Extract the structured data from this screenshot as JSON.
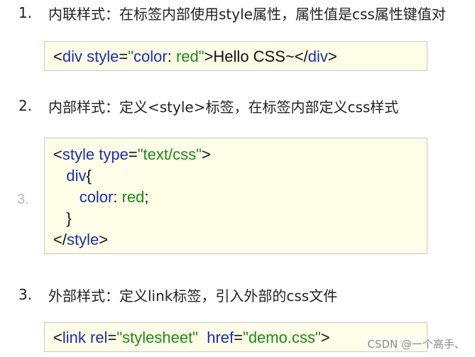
{
  "sections": [
    {
      "number": "1.",
      "title": "内联样式：在标签内部使用style属性，属性值是css属性键值对"
    },
    {
      "number": "2.",
      "title": "内部样式：定义<style>标签，在标签内部定义css样式"
    },
    {
      "number": "3.",
      "title": "外部样式：定义link标签，引入外部的css文件"
    }
  ],
  "code1": {
    "lt": "<",
    "tag": "div",
    "sp": " ",
    "attr": "style",
    "eq": "=",
    "q1": "\"",
    "val_prop": "color",
    "colon": ": ",
    "val_red": "red",
    "q2": "\"",
    "gt": ">",
    "content": "Hello CSS~",
    "close_lt": "</",
    "close_tag": "div",
    "close_gt": ">"
  },
  "code2": {
    "l1_lt": "<",
    "l1_tag": "style",
    "l1_sp": " ",
    "l1_attr": "type",
    "l1_eq": "=",
    "l1_val": "\"text/css\"",
    "l1_gt": ">",
    "l2_indent": "   ",
    "l2_sel": "div",
    "l2_brace": "{",
    "l3_indent": "      ",
    "l3_prop": "color",
    "l3_colon": ": ",
    "l3_val": "red",
    "l3_semi": ";",
    "l4_indent": "   ",
    "l4_brace": "}",
    "l5_lt": "</",
    "l5_tag": "style",
    "l5_gt": ">"
  },
  "faded_number": "3.",
  "code3": {
    "lt": "<",
    "tag": "link",
    "sp1": " ",
    "attr1": "rel",
    "eq1": "=",
    "val1": "\"stylesheet\"",
    "sp2": "  ",
    "attr2": "href",
    "eq2": "=",
    "val2": "\"demo.css\"",
    "gt": ">"
  },
  "watermark": "CSDN @一个高手、"
}
